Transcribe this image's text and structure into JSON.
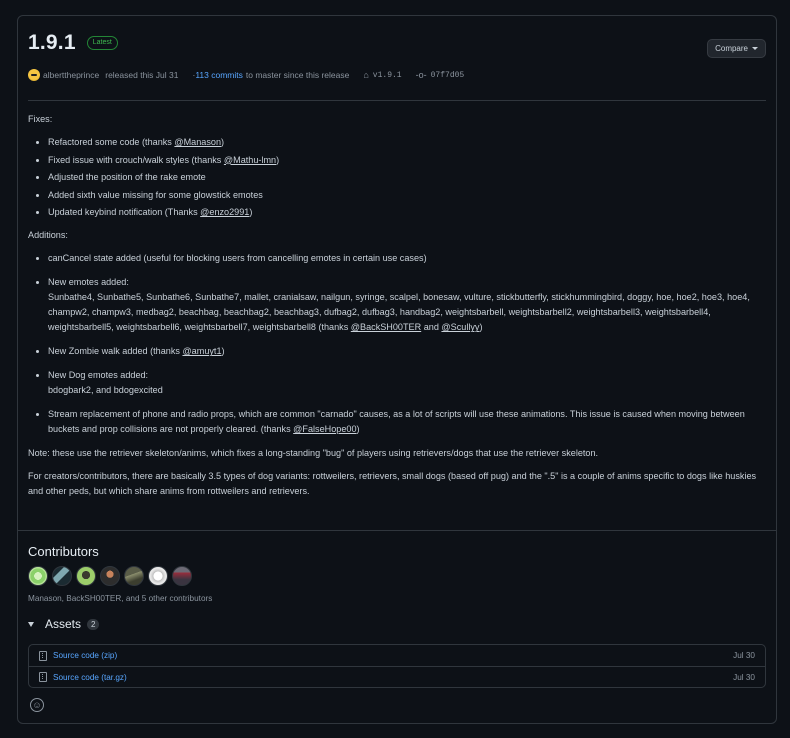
{
  "release": {
    "version": "1.9.1",
    "badge": "Latest",
    "compare_label": "Compare",
    "author": "alberttheprince",
    "released_text": "released this Jul 31",
    "commits_link": "113 commits",
    "commits_text": "to master since this release",
    "tag": "v1.9.1",
    "commit_hash": "07f7d05"
  },
  "notes": {
    "fixes_heading": "Fixes:",
    "fixes": [
      {
        "pre": "Refactored some code (thanks ",
        "mention": "@Manason",
        "post": ")"
      },
      {
        "pre": "Fixed issue with crouch/walk styles (thanks ",
        "mention": "@Mathu-lmn",
        "post": ")"
      },
      {
        "pre": "Adjusted the position of the rake emote",
        "mention": "",
        "post": ""
      },
      {
        "pre": "Added sixth value missing for some glowstick emotes",
        "mention": "",
        "post": ""
      },
      {
        "pre": "Updated keybind notification (Thanks ",
        "mention": "@enzo2991",
        "post": ")"
      }
    ],
    "additions_heading": "Additions:",
    "add_1": "canCancel state added (useful for blocking users from cancelling emotes in certain use cases)",
    "add_2_title": "New emotes added:",
    "add_2_body": "Sunbathe4, Sunbathe5, Sunbathe6, Sunbathe7, mallet, cranialsaw, nailgun, syringe, scalpel, bonesaw, vulture, stickbutterfly, stickhummingbird, doggy, hoe, hoe2, hoe3, hoe4, champw2, champw3, medbag2, beachbag, beachbag2, beachbag3, dufbag2, dufbag3, handbag2, weightsbarbell, weightsbarbell2, weightsbarbell3, weightsbarbell4, weightsbarbell5, weightsbarbell6, weightsbarbell7, weightsbarbell8 (thanks ",
    "add_2_mention1": "@BackSH00TER",
    "add_2_and": " and ",
    "add_2_mention2": "@Scullyy",
    "add_2_close": ")",
    "add_3_pre": "New Zombie walk added (thanks ",
    "add_3_mention": "@amuyt1",
    "add_3_post": ")",
    "add_4_title": "New Dog emotes added:",
    "add_4_body": "bdogbark2, and bdogexcited",
    "add_5_pre": "Stream replacement of phone and radio props, which are common \"carnado\" causes, as a lot of scripts will use these animations. This issue is caused when moving between buckets and prop collisions are not properly cleared. (thanks ",
    "add_5_mention": "@FalseHope00",
    "add_5_post": ")",
    "note": "Note: these use the retriever skeleton/anims, which fixes a long-standing \"bug\" of players using retrievers/dogs that use the retriever skeleton.",
    "creators": "For creators/contributors, there are basically 3.5 types of dog variants: rottweilers, retrievers, small dogs (based off pug) and the \".5\" is a couple of anims specific to dogs like huskies and other peds, but which share anims from rottweilers and retrievers."
  },
  "contributors": {
    "heading": "Contributors",
    "names": "Manason, BackSH00TER, and 5 other contributors"
  },
  "assets": {
    "heading": "Assets",
    "count": "2",
    "items": [
      {
        "name": "Source code (zip)",
        "date": "Jul 30"
      },
      {
        "name": "Source code (tar.gz)",
        "date": "Jul 30"
      }
    ]
  },
  "emoji": "☺"
}
